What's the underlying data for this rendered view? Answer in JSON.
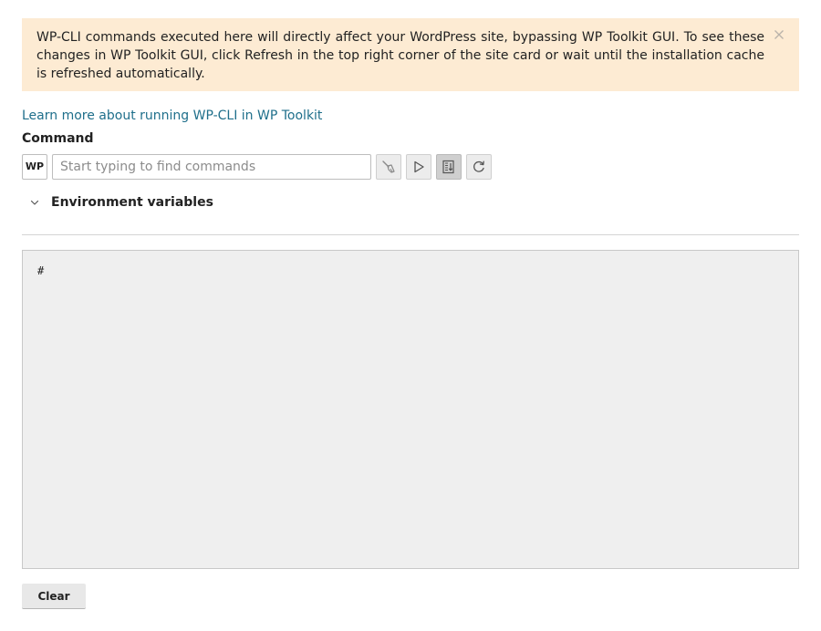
{
  "alert": {
    "message": "WP-CLI commands executed here will directly affect your WordPress site, bypassing WP Toolkit GUI. To see these changes in WP Toolkit GUI, click Refresh in the top right corner of the site card or wait until the installation cache is refreshed automatically.",
    "close_icon": "close-icon",
    "background_color": "#fdebd3"
  },
  "learn_more": {
    "label": "Learn more about running WP-CLI in WP Toolkit",
    "color": "#1f6f8b"
  },
  "command": {
    "label": "Command",
    "prefix": "WP",
    "input_value": "",
    "input_placeholder": "Start typing to find commands",
    "toolbar": [
      {
        "icon": "broom-icon",
        "state": "normal"
      },
      {
        "icon": "play-icon",
        "state": "normal"
      },
      {
        "icon": "autoscroll-icon",
        "state": "active"
      },
      {
        "icon": "refresh-icon",
        "state": "normal"
      }
    ]
  },
  "environment": {
    "label": "Environment variables",
    "icon": "chevron-down-icon",
    "expanded": false
  },
  "console": {
    "prompt": "#",
    "background_color": "#efefef"
  },
  "actions": {
    "clear_label": "Clear"
  }
}
